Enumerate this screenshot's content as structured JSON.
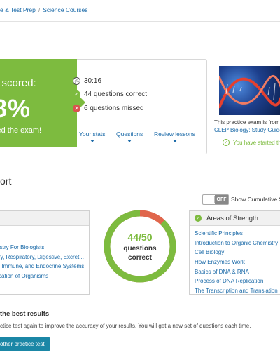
{
  "breadcrumb": {
    "item1": "e & Test Prep",
    "separator": "/",
    "item2": "Science Courses"
  },
  "result": {
    "score_label": "u scored:",
    "score_value": "8%",
    "score_message": "sed the exam!",
    "time": "30:16",
    "correct": "44 questions correct",
    "missed": "6 questions missed",
    "links": [
      "Your stats",
      "Questions",
      "Review lessons"
    ]
  },
  "exam_source": {
    "from_text": "This practice exam is from",
    "course_link": "CLEP Biology: Study Guide",
    "started_text": "You have started th"
  },
  "report": {
    "title": "ort",
    "toggle_state": "OFF",
    "toggle_label": "Show Cumulative S"
  },
  "weakness_panel": {
    "items": [
      "istry For Biologists",
      "ry, Respiratory, Digestive, Excret...",
      ", Immune, and Endocrine Systems",
      "cation of Organisms"
    ]
  },
  "strength_panel": {
    "title": "Areas of Strength",
    "items": [
      "Scientific Principles",
      "Introduction to Organic Chemistry",
      "Cell Biology",
      "How Enzymes Work",
      "Basics of DNA & RNA",
      "Process of DNA Replication",
      "The Transcription and Translation"
    ]
  },
  "donut": {
    "score": "44/50",
    "line1": "questions",
    "line2": "correct",
    "correct_fraction": 0.88,
    "correct_color": "#7dbb3f",
    "missed_color": "#e0664c"
  },
  "best_results": {
    "title": "the best results",
    "description": "ctice test again to improve the accuracy of your results. You will get a new set of questions each time.",
    "button": "other practice test"
  },
  "colors": {
    "accent_green": "#7dbb3f",
    "link_blue": "#1b6aa8",
    "button_teal": "#1b87a6"
  }
}
